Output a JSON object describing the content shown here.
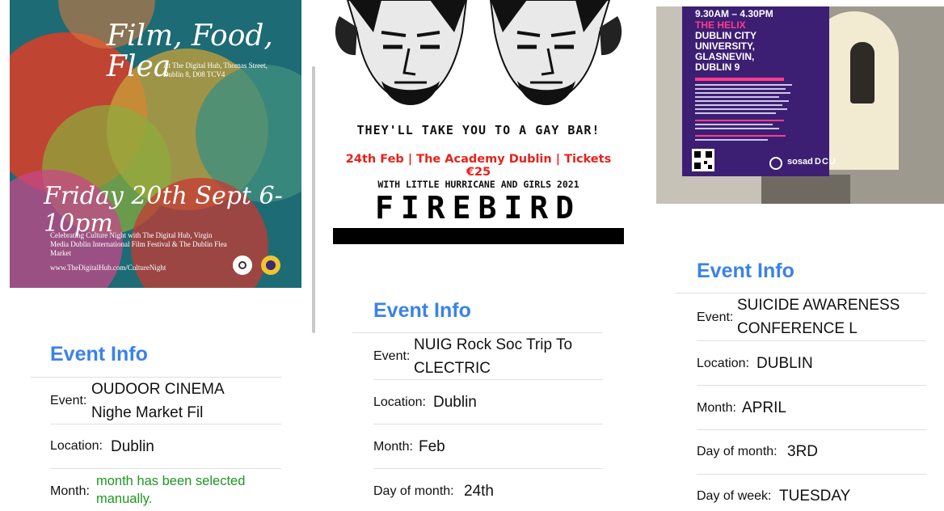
{
  "panel1": {
    "poster": {
      "title_script": "Film, Food, Flea",
      "venue": "At The Digital Hub, Thomas Street, Dublin 8, D08 TCV4",
      "date_script": "Friday 20th Sept 6-10pm",
      "celebrating": "Celebrating Culture Night with The Digital Hub, Virgin Media Dublin International Film Festival & The Dublin Flea Market",
      "url": "www.TheDigitalHub.com/CultureNight"
    },
    "info": {
      "title": "Event Info",
      "event_label": "Event:",
      "event_value": "OUDOOR CINEMA Nighe Market Fil",
      "location_label": "Location:",
      "location_value": "Dublin",
      "month_label": "Month:",
      "month_value": "month has been selected manually."
    }
  },
  "panel2": {
    "poster": {
      "tagline": "THEY'LL TAKE YOU TO A GAY BAR!",
      "dateline": "24th Feb | The Academy Dublin | Tickets €25",
      "supporting": "WITH LITTLE HURRICANE AND GIRLS 2021",
      "band": "FIREBIRD"
    },
    "info": {
      "title": "Event Info",
      "event_label": "Event:",
      "event_value": "NUIG Rock Soc Trip To CLECTRIC",
      "location_label": "Location:",
      "location_value": "Dublin",
      "month_label": "Month:",
      "month_value": "Feb",
      "day_label": "Day of month:",
      "day_value": "24th"
    }
  },
  "panel3": {
    "poster": {
      "time": "9.30AM – 4.30PM",
      "venue_line1": "THE HELIX",
      "venue_line2": "DUBLIN CITY",
      "venue_line3": "UNIVERSITY,",
      "venue_line4": "GLASNEVIN,",
      "venue_line5": "DUBLIN 9",
      "sosad": "sosad",
      "dcu": "DCU"
    },
    "info": {
      "title": "Event Info",
      "event_label": "Event:",
      "event_value": "SUICIDE AWARENESS CONFERENCE L",
      "location_label": "Location:",
      "location_value": "DUBLIN",
      "month_label": "Month:",
      "month_value": "APRIL",
      "day_label": "Day of month:",
      "day_value": "3RD",
      "weekday_label": "Day of week:",
      "weekday_value": "TUESDAY"
    }
  },
  "colors": {
    "accent": "#3a82ea",
    "manual_note": "#1f9620",
    "dateline_red": "#e8211a",
    "poster3_purple": "#3c1f73"
  }
}
